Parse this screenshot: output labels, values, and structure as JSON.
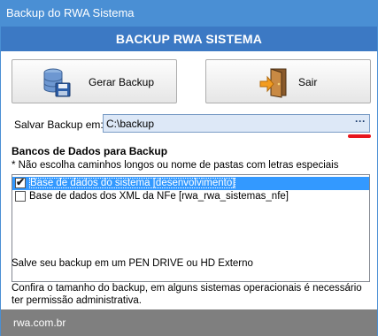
{
  "window": {
    "title": "Backup do RWA Sistema"
  },
  "header": {
    "title": "BACKUP RWA SISTEMA"
  },
  "buttons": {
    "backup": {
      "label": "Gerar Backup",
      "icon": "database-save-icon"
    },
    "exit": {
      "label": "Sair",
      "icon": "exit-door-icon"
    }
  },
  "path": {
    "label": "Salvar Backup em:",
    "value": "C:\\backup",
    "browse_label": "···"
  },
  "databases": {
    "title": "Bancos de Dados para Backup",
    "note": "* Não escolha caminhos longos ou nome de pastas com letras especiais",
    "items": [
      {
        "label": "Base de dados do sistema [desenvolvimento]",
        "checked": true,
        "selected": true
      },
      {
        "label": "Base de dados dos XML da NFe [rwa_rwa_sistemas_nfe]",
        "checked": false,
        "selected": false
      }
    ]
  },
  "tips": {
    "line1": "Salve seu backup em um PEN DRIVE ou HD Externo",
    "line2": "Confira o tamanho do backup, em alguns sistemas operacionais é necessário ter permissão administrativa."
  },
  "footer": {
    "text": "rwa.com.br"
  },
  "colors": {
    "titlebar": "#4a8fd4",
    "banner": "#3c79c4",
    "selection": "#3399ff",
    "footer": "#7f7f7f",
    "highlight": "#e8161d"
  }
}
